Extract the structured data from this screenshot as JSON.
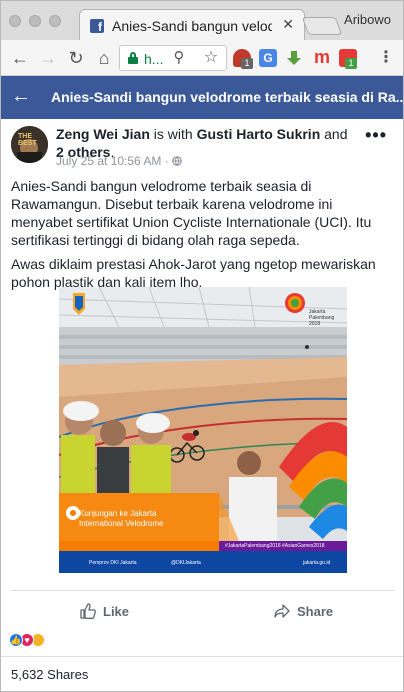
{
  "browser": {
    "tab_title": "Anies-Sandi bangun velodrome terbaik seasia di Rawamangun",
    "tab_close": "✕",
    "favicon_letter": "f",
    "profile_name": "Aribowo",
    "url": "h...",
    "ext_badge_1": "1",
    "ext_badge_2": "1",
    "ext_m": "m",
    "ext_translate": "G"
  },
  "header": {
    "title": "Anies-Sandi bangun velodrome terbaik seasia di Ra..."
  },
  "post": {
    "avatar_text": "THE BEST",
    "author_name": "Zeng Wei Jian",
    "with_text": "is with",
    "tagged_name": "Gusti Harto Sukrin",
    "and_text": "and",
    "others_text": "2 others",
    "timestamp": "July 25 at 10:56 AM",
    "meta_dot": "·",
    "audience_icon": "globe-icon",
    "paragraph_1": "Anies-Sandi bangun velodrome terbaik seasia di Rawamangun. Disebut terbaik karena velodrome ini menyabet sertifikat Union Cycliste Internationale (UCI). Itu sertifikasi tertinggi di bidang olah raga sepeda.",
    "paragraph_2": "Awas diklaim prestasi Ahok-Jarot yang ngetop mewariskan pohon plastik dan kali item lho.",
    "image": {
      "caption_line_1": "Kunjungan ke Jakarta",
      "caption_line_2": "International Velodrome",
      "logo_text_1": "Jakarta",
      "logo_text_2": "Palembang",
      "logo_text_3": "2018",
      "footer_left": "Pemprov DKI Jakarta",
      "footer_mid": "@DKIJakarta",
      "footer_right": "jakarta.go.id",
      "hashtags": "#JakartaPalembang2018  #AsianGames2018"
    }
  },
  "actions": {
    "like_label": "Like",
    "share_label": "Share"
  },
  "stats": {
    "shares_text": "5,632 Shares"
  },
  "colors": {
    "facebook_blue": "#3b5998",
    "link_green": "#0b8043"
  }
}
